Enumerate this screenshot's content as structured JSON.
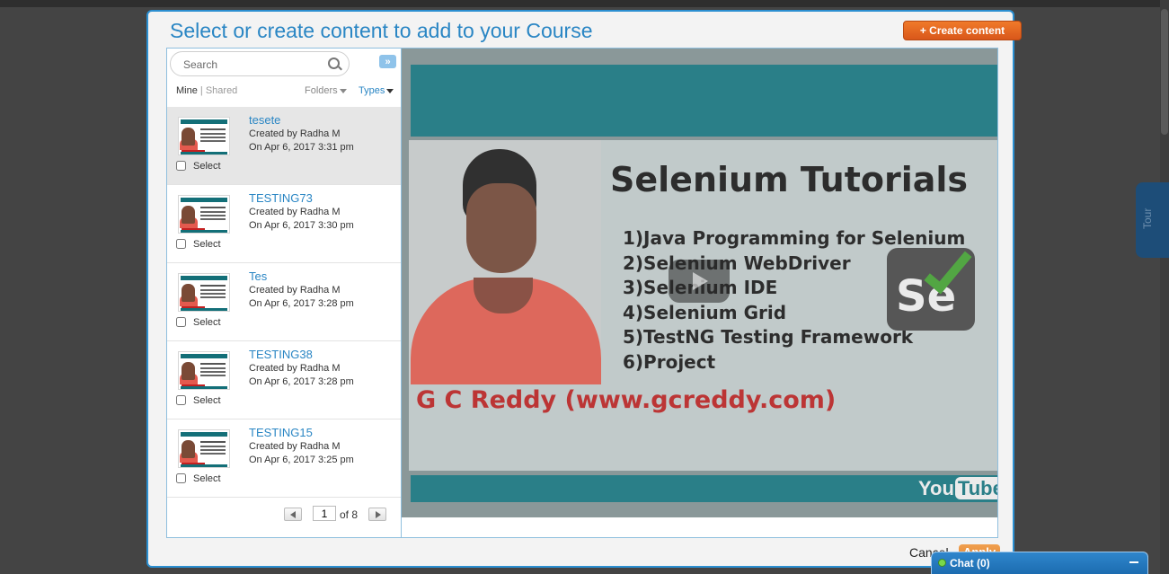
{
  "modal": {
    "title": "Select or create content to add to your Course",
    "create_button": "+ Create content",
    "cancel": "Cancel",
    "apply": "Apply"
  },
  "search": {
    "placeholder": "Search"
  },
  "expand_button": "»",
  "tabs": {
    "mine": "Mine",
    "separator": "|",
    "shared": "Shared"
  },
  "filters": {
    "folders": "Folders",
    "types": "Types"
  },
  "items": [
    {
      "title": "tesete",
      "created_by": "Created by Radha M",
      "date": "On Apr 6, 2017 3:31 pm",
      "select_label": "Select",
      "selected": true
    },
    {
      "title": "TESTING73",
      "created_by": "Created by Radha M",
      "date": "On Apr 6, 2017 3:30 pm",
      "select_label": "Select",
      "selected": false
    },
    {
      "title": "Tes",
      "created_by": "Created by Radha M",
      "date": "On Apr 6, 2017 3:28 pm",
      "select_label": "Select",
      "selected": false
    },
    {
      "title": "TESTING38",
      "created_by": "Created by Radha M",
      "date": "On Apr 6, 2017 3:28 pm",
      "select_label": "Select",
      "selected": false
    },
    {
      "title": "TESTING15",
      "created_by": "Created by Radha M",
      "date": "On Apr 6, 2017 3:25 pm",
      "select_label": "Select",
      "selected": false
    }
  ],
  "pager": {
    "current_page": "1",
    "of_label": "of 8"
  },
  "video": {
    "title": "Selenium Tutorials",
    "list": [
      "1)Java Programming for Selenium",
      "2)Selenium WebDriver",
      "3)Selenium IDE",
      "4)Selenium Grid",
      "5)TestNG Testing Framework",
      "6)Project"
    ],
    "footer": "G C Reddy (www.gcreddy.com)",
    "se_logo": "Se",
    "youtube_1": "You",
    "youtube_2": "Tube"
  },
  "tour_tab": "Tour",
  "chat": {
    "label": "Chat  (0)"
  },
  "colors": {
    "accent": "#2a86c4",
    "create_button": "#e0601f",
    "chat": "#2f86cc"
  }
}
